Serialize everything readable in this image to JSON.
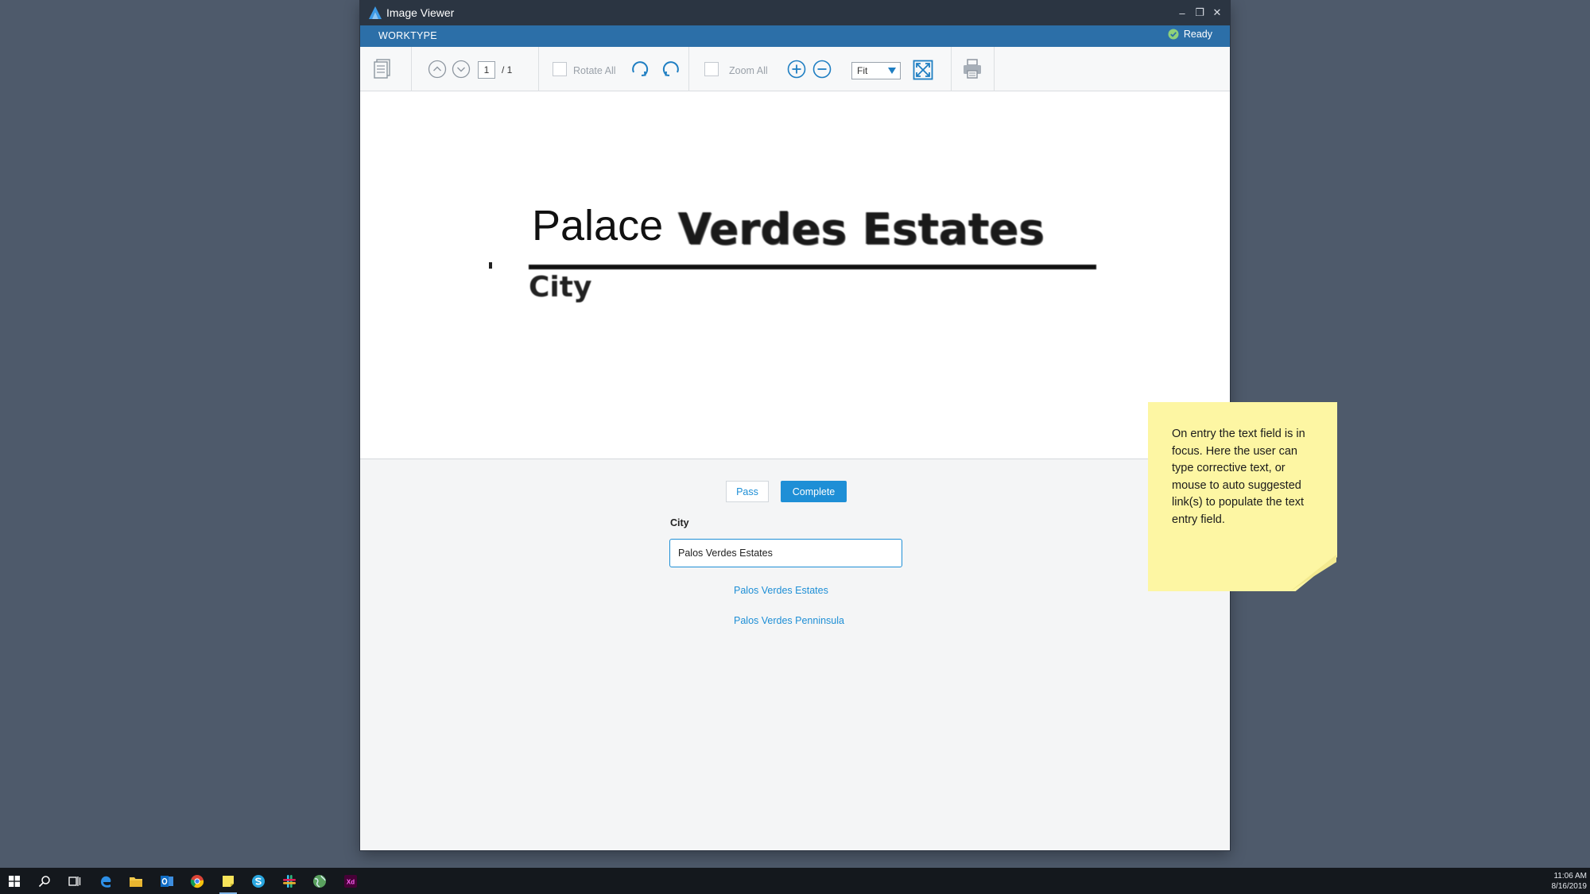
{
  "window": {
    "title": "Image Viewer",
    "controls": {
      "minimize": "–",
      "restore": "❐",
      "close": "✕"
    }
  },
  "worktype_bar": {
    "label": "WORKTYPE",
    "status": "Ready",
    "status_color": "#8fd17a"
  },
  "toolbar": {
    "page_current": "1",
    "page_total": "/ 1",
    "rotate_all_label": "Rotate All",
    "zoom_all_label": "Zoom All",
    "fit_value": "Fit",
    "accent": "#1e7ec2"
  },
  "document": {
    "line1_a": "Palace",
    "line1_b": "Verdes Estates",
    "line2": "City"
  },
  "form": {
    "pass_label": "Pass",
    "complete_label": "Complete",
    "field_label": "City",
    "field_value": "Palos Verdes Estates",
    "suggestions": [
      "Palos Verdes Estates",
      "Palos Verdes Penninsula"
    ],
    "accent": "#1e8fd6"
  },
  "sticky_note": {
    "text": "On entry the text field is in focus. Here the user can type corrective text, or mouse to auto suggested link(s) to populate the text entry field."
  },
  "taskbar": {
    "icons": [
      "start-icon",
      "search-icon",
      "task-view-icon",
      "edge-icon",
      "file-explorer-icon",
      "outlook-icon",
      "chrome-icon",
      "sticky-notes-icon",
      "skype-icon",
      "slack-icon",
      "globe-icon",
      "xd-icon"
    ],
    "time": "11:06 AM",
    "date": "8/16/2019"
  }
}
